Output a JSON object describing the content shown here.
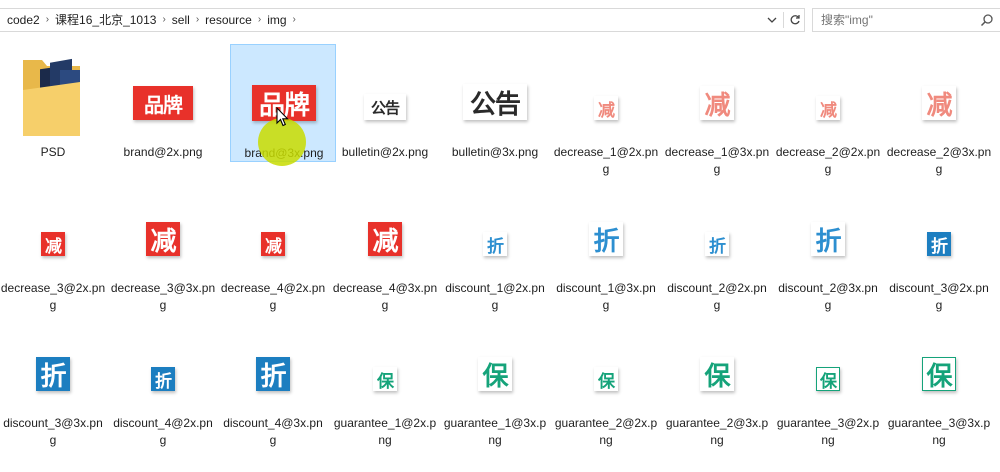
{
  "address_bar": {
    "crumbs": [
      "code2",
      "课程16_北京_1013",
      "sell",
      "resource",
      "img"
    ],
    "dropdown_icon": "chevron-down-icon",
    "refresh_icon": "refresh-icon"
  },
  "search": {
    "placeholder": "搜索\"img\""
  },
  "files": [
    {
      "name": "PSD",
      "kind": "folder"
    },
    {
      "name": "brand@2x.png",
      "glyph": "品牌",
      "scale": 2,
      "style": "red"
    },
    {
      "name": "brand@3x.png",
      "glyph": "品牌",
      "scale": 3,
      "style": "red",
      "selected": true
    },
    {
      "name": "bulletin@2x.png",
      "glyph": "公告",
      "scale": 2,
      "style": "dark"
    },
    {
      "name": "bulletin@3x.png",
      "glyph": "公告",
      "scale": 3,
      "style": "dark"
    },
    {
      "name": "decrease_1@2x.png",
      "glyph": "减",
      "scale": 2,
      "style": "salmon-outline"
    },
    {
      "name": "decrease_1@3x.png",
      "glyph": "减",
      "scale": 3,
      "style": "salmon-outline"
    },
    {
      "name": "decrease_2@2x.png",
      "glyph": "减",
      "scale": 2,
      "style": "salmon-outline"
    },
    {
      "name": "decrease_2@3x.png",
      "glyph": "减",
      "scale": 3,
      "style": "salmon-outline"
    },
    {
      "name": "decrease_3@2x.png",
      "glyph": "减",
      "scale": 2,
      "style": "red"
    },
    {
      "name": "decrease_3@3x.png",
      "glyph": "减",
      "scale": 3,
      "style": "red"
    },
    {
      "name": "decrease_4@2x.png",
      "glyph": "减",
      "scale": 2,
      "style": "red"
    },
    {
      "name": "decrease_4@3x.png",
      "glyph": "减",
      "scale": 3,
      "style": "red"
    },
    {
      "name": "discount_1@2x.png",
      "glyph": "折",
      "scale": 2,
      "style": "blue-outline"
    },
    {
      "name": "discount_1@3x.png",
      "glyph": "折",
      "scale": 3,
      "style": "blue-outline"
    },
    {
      "name": "discount_2@2x.png",
      "glyph": "折",
      "scale": 2,
      "style": "blue-outline"
    },
    {
      "name": "discount_2@3x.png",
      "glyph": "折",
      "scale": 3,
      "style": "blue-outline"
    },
    {
      "name": "discount_3@2x.png",
      "glyph": "折",
      "scale": 2,
      "style": "blue"
    },
    {
      "name": "discount_3@3x.png",
      "glyph": "折",
      "scale": 3,
      "style": "blue"
    },
    {
      "name": "discount_4@2x.png",
      "glyph": "折",
      "scale": 2,
      "style": "blue"
    },
    {
      "name": "discount_4@3x.png",
      "glyph": "折",
      "scale": 3,
      "style": "blue"
    },
    {
      "name": "guarantee_1@2x.png",
      "glyph": "保",
      "scale": 2,
      "style": "green-outline"
    },
    {
      "name": "guarantee_1@3x.png",
      "glyph": "保",
      "scale": 3,
      "style": "green-outline"
    },
    {
      "name": "guarantee_2@2x.png",
      "glyph": "保",
      "scale": 2,
      "style": "green-outline"
    },
    {
      "name": "guarantee_2@3x.png",
      "glyph": "保",
      "scale": 3,
      "style": "green-outline"
    },
    {
      "name": "guarantee_3@2x.png",
      "glyph": "保",
      "scale": 2,
      "style": "green-box"
    },
    {
      "name": "guarantee_3@3x.png",
      "glyph": "保",
      "scale": 3,
      "style": "green-box"
    }
  ],
  "colors": {
    "selection_bg": "#cce8ff",
    "red": "#e8312a",
    "salmon": "#f08a7e",
    "blue": "#1c7ec0",
    "blue_outline": "#2d8fd0",
    "green": "#15a37a",
    "dark": "#2a2a2a"
  }
}
